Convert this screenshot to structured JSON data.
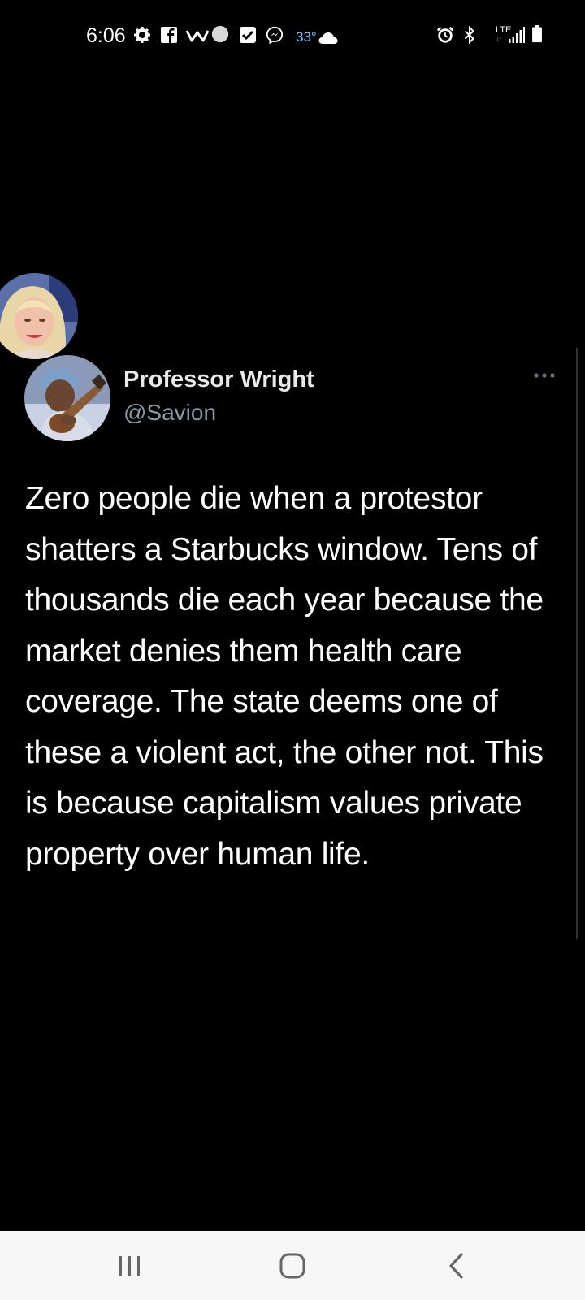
{
  "status_bar": {
    "time": "6:06",
    "temperature": "33°",
    "network": "LTE",
    "icons": [
      "gear-icon",
      "facebook-icon",
      "wattpad-icon",
      "circle-icon",
      "checkbox-icon",
      "messenger-icon",
      "cloud-icon",
      "alarm-icon",
      "bluetooth-icon",
      "signal-icon",
      "battery-icon"
    ]
  },
  "tweet": {
    "display_name": "Professor Wright",
    "handle": "@Savion",
    "text": "Zero people die when a protestor shatters a Starbucks window. Tens of thousands die each year because the market denies them health care coverage. The state deems one of these a violent act, the other not. This is because capitalism values private property over human life."
  },
  "nav_bar": {
    "buttons": [
      "recent-apps",
      "home",
      "back"
    ]
  },
  "colors": {
    "background": "#000000",
    "handle": "#8b98a5",
    "nav_background": "#f7f7f7",
    "temperature": "#7fc4ff"
  }
}
